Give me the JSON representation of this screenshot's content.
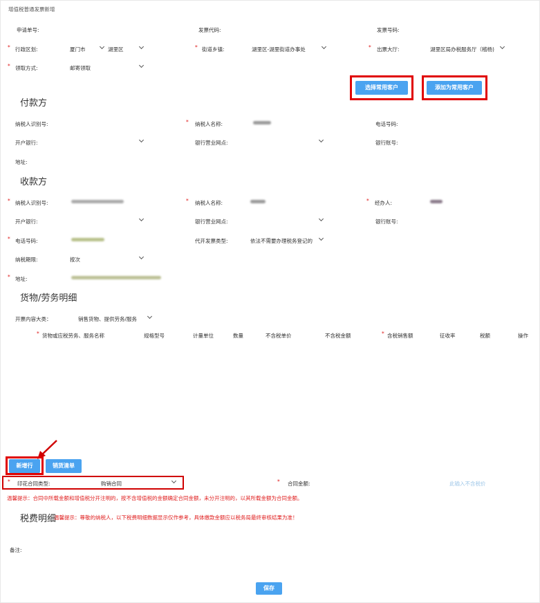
{
  "window": {
    "title": "增值税普通发票新增"
  },
  "top": {
    "apply_no_label": "申请单号:",
    "invoice_code_label": "发票代码:",
    "invoice_no_label": "发票号码:",
    "district_label": "行政区划:",
    "city_value": "厦门市",
    "district_value": "湖里区",
    "street_label": "街道乡镇:",
    "street_value": "湖里区-湖里街道办事处",
    "hall_label": "出票大厅:",
    "hall_value": "湖里区局办税服务厅（稽杨)",
    "pickup_label": "领取方式:",
    "pickup_value": "邮寄领取",
    "select_customer_btn": "选择常用客户",
    "add_customer_btn": "添加为常用客户"
  },
  "payer": {
    "title": "付款方",
    "taxid_label": "纳税人识别号:",
    "name_label": "纳税人名称:",
    "phone_label": "电话号码:",
    "bank_label": "开户银行:",
    "branch_label": "银行营业网点:",
    "account_label": "银行账号:",
    "address_label": "地址:"
  },
  "payee": {
    "title": "收款方",
    "taxid_label": "纳税人识别号:",
    "name_label": "纳税人名称:",
    "agent_label": "经办人:",
    "bank_label": "开户银行:",
    "branch_label": "银行营业网点:",
    "account_label": "银行账号:",
    "phone_label": "电话号码:",
    "invoice_type_label": "代开发票类型:",
    "invoice_type_value": "依法不需要办理税务登记的",
    "period_label": "纳税期限:",
    "period_value": "按次",
    "address_label": "地址:"
  },
  "goods": {
    "title": "货物/劳务明细",
    "category_label": "开票内容大类：",
    "category_value": "销售货物、提供劳务/服务",
    "columns": [
      "货物或应税劳务、服务名称",
      "规格型号",
      "计量单位",
      "数量",
      "不含税单价",
      "不含税金额",
      "含税销售额",
      "征收率",
      "税额",
      "操作"
    ],
    "add_row_btn": "新增行",
    "sales_list_btn": "销货清单"
  },
  "contract": {
    "type_label": "印花合同类型:",
    "type_value": "购销合同",
    "amount_label": "合同金额:",
    "amount_placeholder": "此输入不含税价",
    "hint": "温馨提示：合同中所载金额和增值税分开注明的，按不含增值税的金额确定合同金额，未分开注明的，以其所载金额为合同金额。"
  },
  "tax": {
    "title": "税费明细",
    "hint": "温馨提示：尊敬的纳税人，以下税费明细数据显示仅作参考，具体缴款金额应以税务局最终审核结果为准！"
  },
  "remark_label": "备注:",
  "save_btn": "保存",
  "required_mark": "*"
}
